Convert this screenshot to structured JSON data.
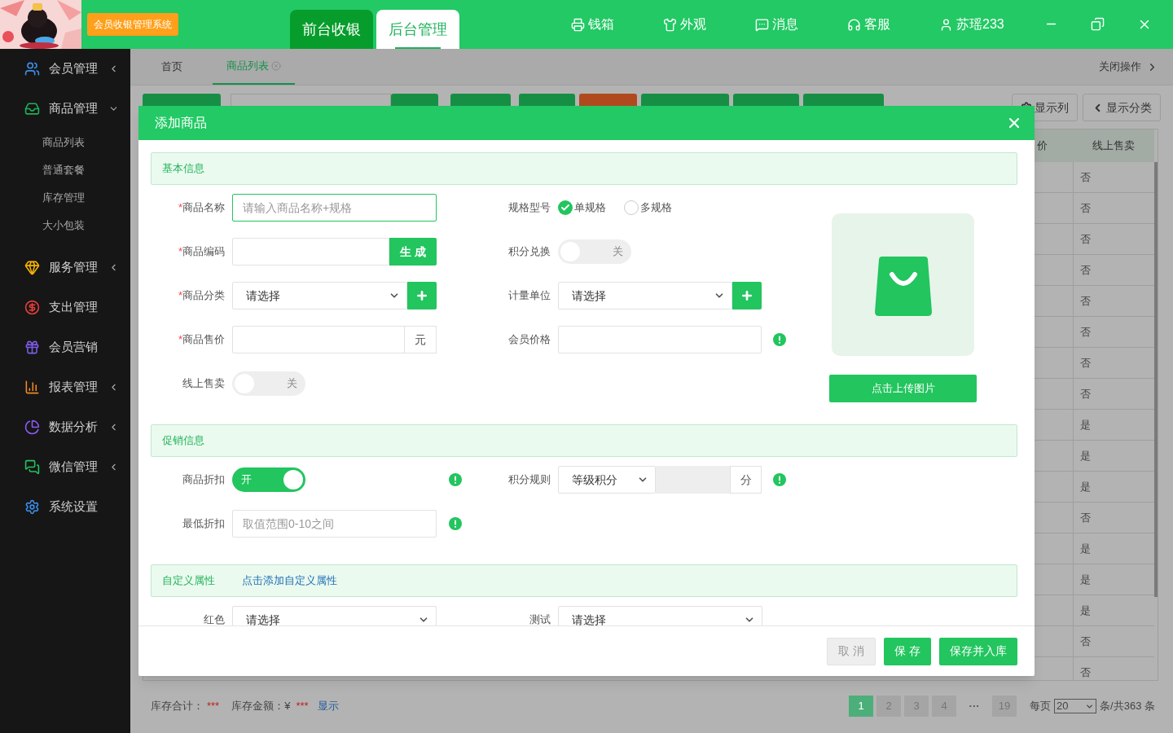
{
  "app": {
    "badge": "会员收银管理系统"
  },
  "mode_tabs": [
    {
      "label": "前台收银",
      "selected": false
    },
    {
      "label": "后台管理",
      "selected": true
    }
  ],
  "top_menu": [
    {
      "label": "钱箱"
    },
    {
      "label": "外观"
    },
    {
      "label": "消息"
    },
    {
      "label": "客服"
    },
    {
      "label": "苏瑶233"
    }
  ],
  "sidebar": {
    "items": [
      {
        "label": "会员管理",
        "kind": "group",
        "expanded": false
      },
      {
        "label": "商品管理",
        "kind": "group",
        "expanded": true,
        "children": [
          {
            "label": "商品列表"
          },
          {
            "label": "普通套餐"
          },
          {
            "label": "库存管理"
          },
          {
            "label": "大小包装"
          }
        ]
      },
      {
        "label": "服务管理",
        "kind": "group",
        "expanded": false
      },
      {
        "label": "支出管理",
        "kind": "link"
      },
      {
        "label": "会员营销",
        "kind": "link"
      },
      {
        "label": "报表管理",
        "kind": "group",
        "expanded": false
      },
      {
        "label": "数据分析",
        "kind": "group",
        "expanded": false
      },
      {
        "label": "微信管理",
        "kind": "group",
        "expanded": false
      },
      {
        "label": "系统设置",
        "kind": "link"
      }
    ]
  },
  "page_tabs": [
    {
      "label": "首页",
      "selected": false,
      "closable": false
    },
    {
      "label": "商品列表",
      "selected": true,
      "closable": true
    }
  ],
  "close_ops": "关闭操作",
  "toolbar_right": [
    "显示列",
    "显示分类"
  ],
  "table": {
    "columns": [
      "价",
      "线上售卖"
    ],
    "rows": [
      {
        "online_sale": "否"
      },
      {
        "online_sale": "否"
      },
      {
        "online_sale": "否"
      },
      {
        "online_sale": "否"
      },
      {
        "online_sale": "否"
      },
      {
        "online_sale": "否"
      },
      {
        "online_sale": "否"
      },
      {
        "online_sale": "否"
      },
      {
        "online_sale": "是"
      },
      {
        "online_sale": "是"
      },
      {
        "online_sale": "是"
      },
      {
        "online_sale": "否"
      },
      {
        "online_sale": "是"
      },
      {
        "online_sale": "是"
      },
      {
        "online_sale": "是"
      },
      {
        "online_sale": "否"
      },
      {
        "online_sale": "否"
      }
    ]
  },
  "footer": {
    "stock_total_label": "库存合计：",
    "stock_total": "***",
    "stock_amount_label": "库存金额：¥",
    "stock_amount": "***",
    "show_link": "显示"
  },
  "pagination": {
    "pages": [
      {
        "label": "1",
        "selected": true
      },
      {
        "label": "2",
        "selected": false
      },
      {
        "label": "3",
        "selected": false
      },
      {
        "label": "4",
        "selected": false
      }
    ],
    "ellipsis": "···",
    "last": "19",
    "per_page_label": "每页",
    "per_page": "20",
    "total": "条/共363 条"
  },
  "modal": {
    "title": "添加商品",
    "required_mark": "*",
    "basic": {
      "title": "基本信息",
      "name": {
        "label": "商品名称",
        "required": true,
        "focused": true,
        "placeholder": "请输入商品名称+规格"
      },
      "spec": {
        "label": "规格型号",
        "options": [
          {
            "label": "单规格",
            "selected": true
          },
          {
            "label": "多规格",
            "selected": false
          }
        ]
      },
      "code": {
        "label": "商品编码",
        "required": true,
        "button": "生 成"
      },
      "points_exchange": {
        "label": "积分兑换",
        "on": false,
        "state_text": "关"
      },
      "category": {
        "label": "商品分类",
        "required": true,
        "value": "请选择"
      },
      "unit": {
        "label": "计量单位",
        "value": "请选择"
      },
      "price": {
        "label": "商品售价",
        "required": true,
        "suffix": "元"
      },
      "member_price": {
        "label": "会员价格"
      },
      "online_sale": {
        "label": "线上售卖",
        "on": false,
        "state_text": "关"
      },
      "upload_button": "点击上传图片"
    },
    "promo": {
      "title": "促销信息",
      "discount": {
        "label": "商品折扣",
        "on": true,
        "state_text": "开"
      },
      "points_rule": {
        "label": "积分规则",
        "value": "等级积分",
        "suffix": "分"
      },
      "min_discount": {
        "label": "最低折扣",
        "placeholder": "取值范围0-10之间"
      }
    },
    "custom": {
      "title": "自定义属性",
      "add_link": "点击添加自定义属性",
      "fields": [
        {
          "label": "红色",
          "value": "请选择"
        },
        {
          "label": "测试",
          "value": "请选择"
        }
      ]
    },
    "buttons": [
      {
        "label": "取 消",
        "kind": "cancel"
      },
      {
        "label": "保 存",
        "kind": "primary"
      },
      {
        "label": "保存并入库",
        "kind": "primary"
      }
    ]
  }
}
